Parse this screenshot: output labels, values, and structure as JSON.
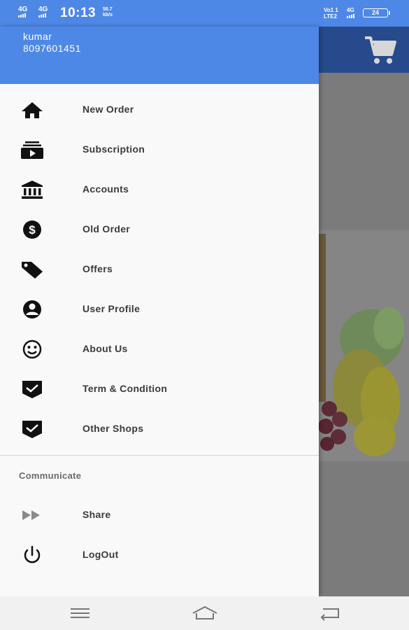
{
  "status_bar": {
    "sim1": "4G",
    "sim2": "4G",
    "time": "10:13",
    "speed_value": "56.7",
    "speed_unit": "kb/s",
    "volte_top": "Vo1 1",
    "volte_bottom": "LTE2",
    "net": "4G",
    "battery": "24"
  },
  "drawer": {
    "user": {
      "name": "kumar",
      "phone": "8097601451"
    },
    "menu_items": [
      {
        "label": "New Order",
        "icon": "home-icon"
      },
      {
        "label": "Subscription",
        "icon": "subscriptions-icon"
      },
      {
        "label": "Accounts",
        "icon": "bank-icon"
      },
      {
        "label": "Old Order",
        "icon": "dollar-circle-icon"
      },
      {
        "label": "Offers",
        "icon": "tag-icon"
      },
      {
        "label": "User Profile",
        "icon": "account-circle-icon"
      },
      {
        "label": "About Us",
        "icon": "smiley-icon"
      },
      {
        "label": "Term & Condition",
        "icon": "verified-badge-icon"
      },
      {
        "label": "Other Shops",
        "icon": "verified-badge-icon"
      }
    ],
    "section_title": "Communicate",
    "communicate_items": [
      {
        "label": "Share",
        "icon": "fast-forward-icon"
      },
      {
        "label": "LogOut",
        "icon": "power-icon"
      }
    ]
  },
  "colors": {
    "header_blue": "#4e88e6",
    "appbar_dark_blue": "#274a8c",
    "drawer_bg": "#f9f9f9"
  }
}
